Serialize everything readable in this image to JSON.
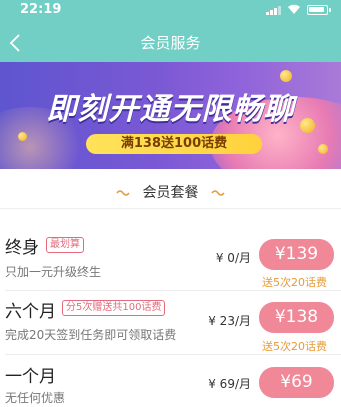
{
  "status": {
    "time": "22:19"
  },
  "header": {
    "title": "会员服务"
  },
  "banner": {
    "headline": "即刻开通无限畅聊",
    "promo": "满138送100话费"
  },
  "section": {
    "title": "会员套餐"
  },
  "plans": [
    {
      "name": "终身",
      "tag": "最划算",
      "desc": "只加一元升级终生",
      "monthly": "¥ 0/月",
      "price": "¥139",
      "gift": "送5次20话费"
    },
    {
      "name": "六个月",
      "tag": "分5次赠送共100话费",
      "desc": "完成20天签到任务即可领取话费",
      "monthly": "¥ 23/月",
      "price": "¥138",
      "gift": "送5次20话费"
    },
    {
      "name": "一个月",
      "tag": "",
      "desc": "无任何优惠",
      "monthly": "¥ 69/月",
      "price": "¥69",
      "gift": ""
    }
  ],
  "colors": {
    "header": "#72cfc6",
    "price_button": "#f08898",
    "tag": "#e56c7c",
    "gift": "#e79a3b"
  }
}
